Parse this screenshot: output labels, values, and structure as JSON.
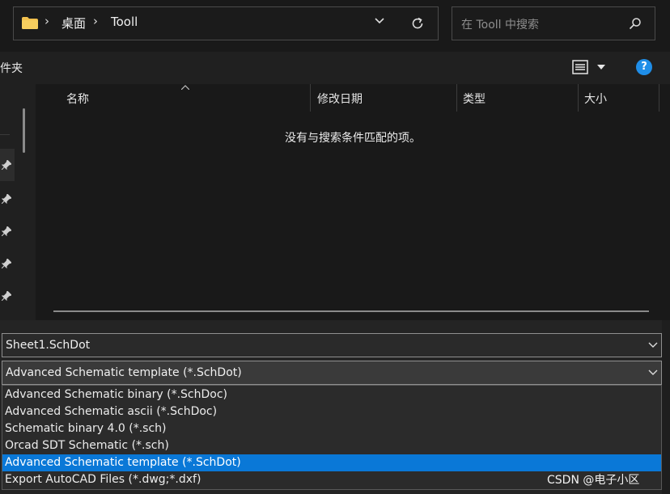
{
  "address_bar": {
    "breadcrumb": [
      "桌面",
      "Tooll"
    ],
    "separator": "›"
  },
  "search": {
    "placeholder": "在 Tooll 中搜索"
  },
  "toolbar": {
    "left_label": "件夹",
    "help_label": "?"
  },
  "columns": [
    {
      "label": "名称"
    },
    {
      "label": "修改日期"
    },
    {
      "label": "类型"
    },
    {
      "label": "大小"
    }
  ],
  "empty_message": "没有与搜索条件匹配的项。",
  "filename": {
    "value": "Sheet1.SchDot"
  },
  "save_type": {
    "selected": "Advanced Schematic template (*.SchDot)",
    "options": [
      "Advanced Schematic binary (*.SchDoc)",
      "Advanced Schematic ascii (*.SchDoc)",
      "Schematic binary 4.0 (*.sch)",
      "Orcad SDT Schematic (*.sch)",
      "Advanced Schematic template (*.SchDot)",
      "Export AutoCAD Files (*.dwg;*.dxf)"
    ],
    "highlighted_index": 4
  },
  "watermark": "CSDN @电子小区",
  "colors": {
    "accent": "#0a78d7",
    "help": "#1f8ee8",
    "folder": "#f2c14e"
  }
}
